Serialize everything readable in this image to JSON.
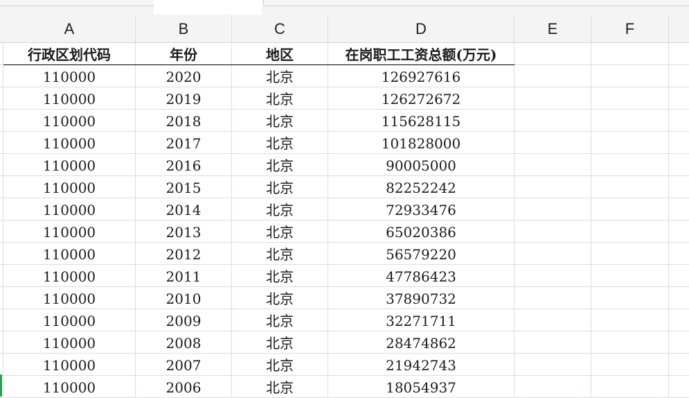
{
  "columns": [
    "A",
    "B",
    "C",
    "D",
    "E",
    "F"
  ],
  "header_row": {
    "a": "行政区划代码",
    "b": "年份",
    "c": "地区",
    "d": "在岗职工工资总额(万元)"
  },
  "rows": [
    {
      "a": "110000",
      "b": "2020",
      "c": "北京",
      "d": "126927616"
    },
    {
      "a": "110000",
      "b": "2019",
      "c": "北京",
      "d": "126272672"
    },
    {
      "a": "110000",
      "b": "2018",
      "c": "北京",
      "d": "115628115"
    },
    {
      "a": "110000",
      "b": "2017",
      "c": "北京",
      "d": "101828000"
    },
    {
      "a": "110000",
      "b": "2016",
      "c": "北京",
      "d": "90005000"
    },
    {
      "a": "110000",
      "b": "2015",
      "c": "北京",
      "d": "82252242"
    },
    {
      "a": "110000",
      "b": "2014",
      "c": "北京",
      "d": "72933476"
    },
    {
      "a": "110000",
      "b": "2013",
      "c": "北京",
      "d": "65020386"
    },
    {
      "a": "110000",
      "b": "2012",
      "c": "北京",
      "d": "56579220"
    },
    {
      "a": "110000",
      "b": "2011",
      "c": "北京",
      "d": "47786423"
    },
    {
      "a": "110000",
      "b": "2010",
      "c": "北京",
      "d": "37890732"
    },
    {
      "a": "110000",
      "b": "2009",
      "c": "北京",
      "d": "32271711"
    },
    {
      "a": "110000",
      "b": "2008",
      "c": "北京",
      "d": "28474862"
    },
    {
      "a": "110000",
      "b": "2007",
      "c": "北京",
      "d": "21942743"
    },
    {
      "a": "110000",
      "b": "2006",
      "c": "北京",
      "d": "18054937"
    }
  ]
}
